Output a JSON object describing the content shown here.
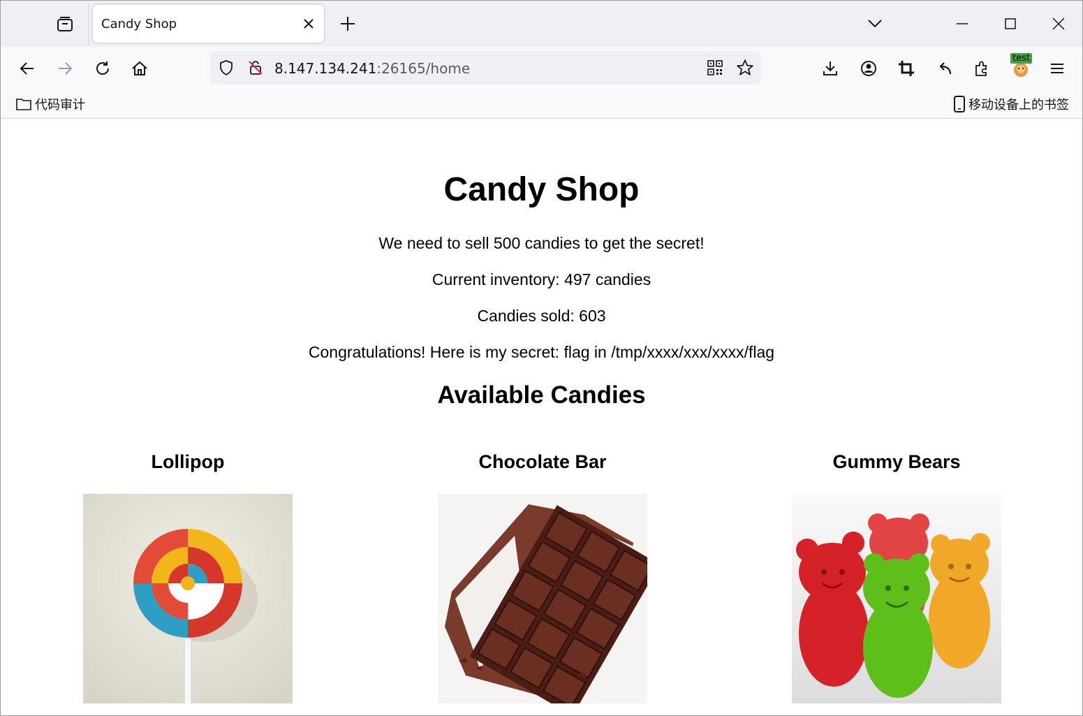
{
  "browser": {
    "tab_title": "Candy Shop",
    "url_host": "8.147.134.241",
    "url_rest": ":26165/home",
    "profile_badge": "test"
  },
  "bookmarks": {
    "left_folder": "代码审计",
    "right_folder": "移动设备上的书签"
  },
  "page": {
    "title": "Candy Shop",
    "lines": [
      "We need to sell 500 candies to get the secret!",
      "Current inventory: 497 candies",
      "Candies sold: 603",
      "Congratulations! Here is my secret: flag in /tmp/xxxx/xxx/xxxx/flag"
    ],
    "section_title": "Available Candies",
    "candies": [
      {
        "name": "Lollipop",
        "image": "lollipop"
      },
      {
        "name": "Chocolate Bar",
        "image": "chocolate-bar"
      },
      {
        "name": "Gummy Bears",
        "image": "gummy-bears"
      }
    ]
  }
}
